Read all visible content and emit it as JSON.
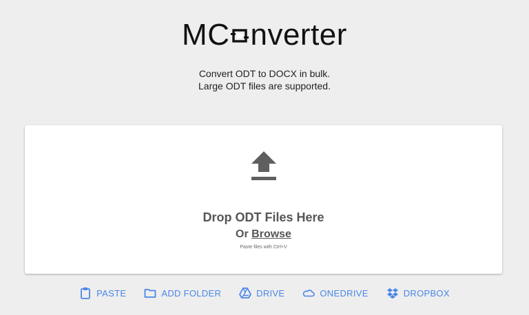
{
  "app": {
    "logo_left": "MC",
    "logo_right": "nverter"
  },
  "tagline": {
    "line1": "Convert ODT to DOCX in bulk.",
    "line2": "Large ODT files are supported."
  },
  "dropzone": {
    "title": "Drop ODT Files Here",
    "or_label": "Or",
    "browse_label": "Browse",
    "hint": "Paste files with Ctrl+V",
    "icon": "upload-icon"
  },
  "toolbar": {
    "items": [
      {
        "label": "PASTE",
        "icon": "clipboard-icon"
      },
      {
        "label": "ADD FOLDER",
        "icon": "folder-icon"
      },
      {
        "label": "DRIVE",
        "icon": "google-drive-icon"
      },
      {
        "label": "ONEDRIVE",
        "icon": "onedrive-icon"
      },
      {
        "label": "DROPBOX",
        "icon": "dropbox-icon"
      }
    ]
  },
  "colors": {
    "background": "#eeeeee",
    "accent": "#4a86e8",
    "icon_gray": "#555555"
  }
}
